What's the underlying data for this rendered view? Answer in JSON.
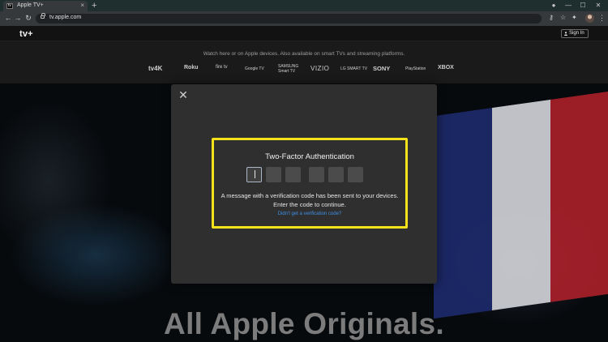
{
  "browser": {
    "tab_favicon_text": "tv",
    "tab_title": "Apple TV+",
    "tab_close": "×",
    "new_tab": "+",
    "url": "tv.apple.com",
    "window_controls": [
      "—",
      "☐",
      "✕"
    ]
  },
  "app": {
    "logo": "tv+",
    "sign_in": "Sign In"
  },
  "banner": {
    "text": "Watch here or on Apple devices. Also available on smart TVs and streaming platforms.",
    "brands": [
      "tv4K",
      "Roku",
      "fire tv",
      "Google TV",
      "SAMSUNG Smart TV",
      "VIZIO",
      "LG SMART TV",
      "SONY",
      "PlayStation",
      "XBOX"
    ]
  },
  "hero": {
    "title": "All Apple Originals."
  },
  "modal": {
    "close": "✕",
    "title": "Two-Factor Authentication",
    "code_digits": [
      "",
      "",
      "",
      "",
      "",
      ""
    ],
    "message": "A message with a verification code has been sent to your devices. Enter the code to continue.",
    "link": "Didn't get a verification code?"
  },
  "colors": {
    "highlight": "#f4e21a",
    "link": "#3f8fe6",
    "modal_bg": "#2f2f2f"
  }
}
